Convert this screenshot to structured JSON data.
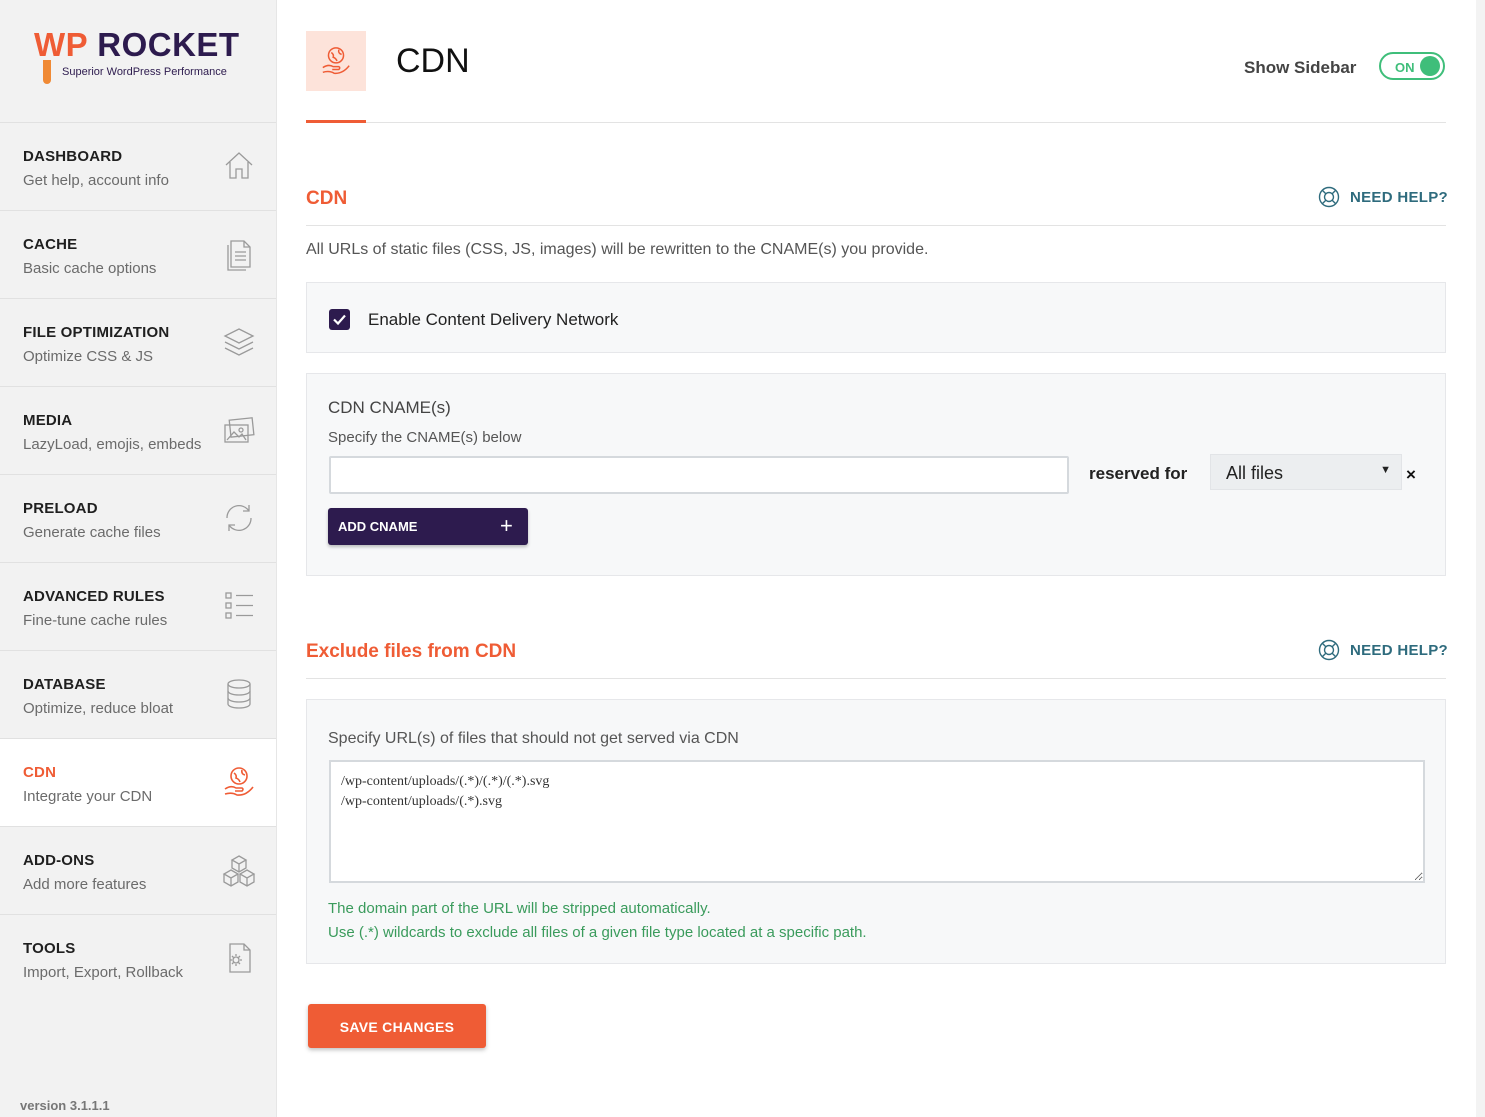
{
  "brand": {
    "name_part1": "WP",
    "name_part2": "ROCKET",
    "tagline": "Superior WordPress Performance",
    "accent_color": "#ef5c35",
    "dark_color": "#2d1b4e"
  },
  "sidebar": {
    "items": [
      {
        "title": "DASHBOARD",
        "subtitle": "Get help, account info",
        "icon": "home-icon"
      },
      {
        "title": "CACHE",
        "subtitle": "Basic cache options",
        "icon": "file-icon"
      },
      {
        "title": "FILE OPTIMIZATION",
        "subtitle": "Optimize CSS & JS",
        "icon": "layers-icon"
      },
      {
        "title": "MEDIA",
        "subtitle": "LazyLoad, emojis, embeds",
        "icon": "images-icon"
      },
      {
        "title": "PRELOAD",
        "subtitle": "Generate cache files",
        "icon": "refresh-icon"
      },
      {
        "title": "ADVANCED RULES",
        "subtitle": "Fine-tune cache rules",
        "icon": "checklist-icon"
      },
      {
        "title": "DATABASE",
        "subtitle": "Optimize, reduce bloat",
        "icon": "database-icon"
      },
      {
        "title": "CDN",
        "subtitle": "Integrate your CDN",
        "icon": "cdn-globe-hand-icon",
        "active": true
      },
      {
        "title": "ADD-ONS",
        "subtitle": "Add more features",
        "icon": "cubes-icon"
      },
      {
        "title": "TOOLS",
        "subtitle": "Import, Export, Rollback",
        "icon": "gear-file-icon"
      }
    ],
    "version": "version 3.1.1.1"
  },
  "header": {
    "title": "CDN",
    "show_sidebar_label": "Show Sidebar",
    "toggle_label": "ON"
  },
  "cdn_section": {
    "title": "CDN",
    "help_label": "NEED HELP?",
    "description": "All URLs of static files (CSS, JS, images) will be rewritten to the CNAME(s) you provide.",
    "enable_label": "Enable Content Delivery Network",
    "enable_checked": true,
    "cname_title": "CDN CNAME(s)",
    "cname_subtitle": "Specify the CNAME(s) below",
    "cname_value": "",
    "reserved_label": "reserved for",
    "reserved_value": "All files",
    "remove_label": "×",
    "add_cname_label": "ADD CNAME",
    "add_icon": "+"
  },
  "exclude_section": {
    "title": "Exclude files from CDN",
    "help_label": "NEED HELP?",
    "field_label": "Specify URL(s) of files that should not get served via CDN",
    "value": "/wp-content/uploads/(.*)/(.*)/(.*).svg\n/wp-content/uploads/(.*).svg",
    "note_1": "The domain part of the URL will be stripped automatically.",
    "note_2": "Use (.*) wildcards to exclude all files of a given file type located at a specific path."
  },
  "save_label": "SAVE CHANGES"
}
